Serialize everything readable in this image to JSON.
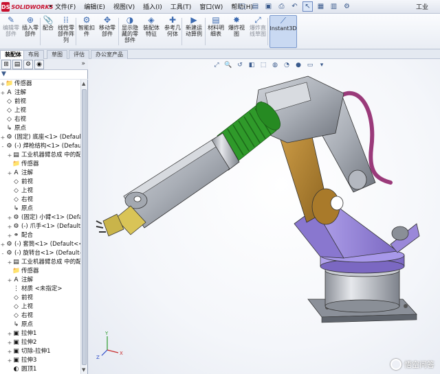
{
  "app": {
    "brand": "SOLIDWORKS",
    "logo_text": "DS",
    "title_partial": "工业"
  },
  "menu": {
    "items": [
      "文件(F)",
      "编辑(E)",
      "视图(V)",
      "插入(I)",
      "工具(T)",
      "窗口(W)",
      "帮助(H)"
    ]
  },
  "quick_access": [
    {
      "icon": "new-document-icon",
      "glyph": "□"
    },
    {
      "icon": "open-icon",
      "glyph": "▤"
    },
    {
      "icon": "save-icon",
      "glyph": "▣"
    },
    {
      "icon": "print-icon",
      "glyph": "⎙"
    },
    {
      "icon": "undo-icon",
      "glyph": "↶"
    },
    {
      "icon": "select-icon",
      "glyph": "↖",
      "selected": true
    },
    {
      "icon": "rebuild-icon",
      "glyph": "▦"
    },
    {
      "icon": "file-properties-icon",
      "glyph": "▥"
    },
    {
      "icon": "options-icon",
      "glyph": "⚙"
    }
  ],
  "commands": [
    {
      "label": "编辑零\n部件",
      "icon": "edit-component-icon",
      "glyph": "✎",
      "gray": true
    },
    {
      "label": "插入零\n部件",
      "icon": "insert-component-icon",
      "glyph": "⊕"
    },
    {
      "label": "配合",
      "icon": "mate-icon",
      "glyph": "📎"
    },
    {
      "label": "线性零\n部件阵\n列",
      "icon": "linear-pattern-icon",
      "glyph": "⁞⁞"
    },
    {
      "label": "智能扣\n件",
      "icon": "smart-fasteners-icon",
      "glyph": "⚙"
    },
    {
      "label": "移动零\n部件",
      "icon": "move-component-icon",
      "glyph": "✥"
    },
    {
      "label": "显示隐\n藏的零\n部件",
      "icon": "show-hidden-icon",
      "glyph": "◑"
    },
    {
      "label": "装配体\n特征",
      "icon": "assembly-features-icon",
      "glyph": "◈"
    },
    {
      "label": "参考几\n何体",
      "icon": "reference-geometry-icon",
      "glyph": "✚"
    },
    {
      "label": "新建运\n动算例",
      "icon": "new-motion-study-icon",
      "glyph": "▶"
    },
    {
      "label": "材料明\n细表",
      "icon": "bom-icon",
      "glyph": "▤"
    },
    {
      "label": "爆炸视\n图",
      "icon": "exploded-view-icon",
      "glyph": "✸"
    },
    {
      "label": "爆炸直\n线草图",
      "icon": "explode-line-sketch-icon",
      "glyph": "⤢",
      "gray": true
    },
    {
      "label": "Instant3D",
      "icon": "instant3d-icon",
      "glyph": "⟋",
      "active": true
    }
  ],
  "tabs": [
    "装配体",
    "布局",
    "草图",
    "评估",
    "办公室产品"
  ],
  "active_tab": 0,
  "feature_manager": {
    "tab_icons": [
      {
        "icon": "feature-tree-icon",
        "glyph": "⊞"
      },
      {
        "icon": "property-manager-icon",
        "glyph": "▤"
      },
      {
        "icon": "configuration-manager-icon",
        "glyph": "⚙"
      },
      {
        "icon": "display-manager-icon",
        "glyph": "◉"
      }
    ],
    "collapse_glyph": "»",
    "filter_glyph": "▼",
    "tree": [
      {
        "indent": 0,
        "exp": "+",
        "icon": "sensor-icon",
        "glyph": "📁",
        "text": "传感器"
      },
      {
        "indent": 0,
        "exp": "+",
        "icon": "annotation-icon",
        "glyph": "A",
        "text": "注解"
      },
      {
        "indent": 0,
        "exp": "",
        "icon": "plane-icon",
        "glyph": "◇",
        "text": "前视"
      },
      {
        "indent": 0,
        "exp": "",
        "icon": "plane-icon",
        "glyph": "◇",
        "text": "上视"
      },
      {
        "indent": 0,
        "exp": "",
        "icon": "plane-icon",
        "glyph": "◇",
        "text": "右视"
      },
      {
        "indent": 0,
        "exp": "",
        "icon": "origin-icon",
        "glyph": "↳",
        "text": "原点"
      },
      {
        "indent": 0,
        "exp": "+",
        "icon": "part-icon",
        "glyph": "⚙",
        "text": "(固定) 底座<1> (Default"
      },
      {
        "indent": 0,
        "exp": "-",
        "icon": "subassembly-icon",
        "glyph": "⚙",
        "text": "(-) 焊枪结构<1> (Defau"
      },
      {
        "indent": 1,
        "exp": "+",
        "icon": "history-icon",
        "glyph": "▤",
        "text": "工业机器臂总成 中的配"
      },
      {
        "indent": 1,
        "exp": "",
        "icon": "sensor-icon",
        "glyph": "📁",
        "text": "传感器"
      },
      {
        "indent": 1,
        "exp": "+",
        "icon": "annotation-icon",
        "glyph": "A",
        "text": "注解"
      },
      {
        "indent": 1,
        "exp": "",
        "icon": "plane-icon",
        "glyph": "◇",
        "text": "前视"
      },
      {
        "indent": 1,
        "exp": "",
        "icon": "plane-icon",
        "glyph": "◇",
        "text": "上视"
      },
      {
        "indent": 1,
        "exp": "",
        "icon": "plane-icon",
        "glyph": "◇",
        "text": "右视"
      },
      {
        "indent": 1,
        "exp": "",
        "icon": "origin-icon",
        "glyph": "↳",
        "text": "原点"
      },
      {
        "indent": 1,
        "exp": "+",
        "icon": "part-icon",
        "glyph": "⚙",
        "text": "(固定) 小臂<1> (Defa"
      },
      {
        "indent": 1,
        "exp": "+",
        "icon": "part-icon",
        "glyph": "⚙",
        "text": "(-) 爪手<1> (Default"
      },
      {
        "indent": 1,
        "exp": "+",
        "icon": "mates-icon",
        "glyph": "⚭",
        "text": "配合"
      },
      {
        "indent": 0,
        "exp": "+",
        "icon": "part-icon",
        "glyph": "⚙",
        "text": "(-) 套筒<1> (Default<<"
      },
      {
        "indent": 0,
        "exp": "-",
        "icon": "part-icon",
        "glyph": "⚙",
        "text": "(-) 旋转台<1> (Default-"
      },
      {
        "indent": 1,
        "exp": "+",
        "icon": "history-icon",
        "glyph": "▤",
        "text": "工业机器臂总成 中的配"
      },
      {
        "indent": 1,
        "exp": "",
        "icon": "sensor-icon",
        "glyph": "📁",
        "text": "传感器"
      },
      {
        "indent": 1,
        "exp": "+",
        "icon": "annotation-icon",
        "glyph": "A",
        "text": "注解"
      },
      {
        "indent": 1,
        "exp": "",
        "icon": "material-icon",
        "glyph": "⋮",
        "text": "材质 <未指定>"
      },
      {
        "indent": 1,
        "exp": "",
        "icon": "plane-icon",
        "glyph": "◇",
        "text": "前视"
      },
      {
        "indent": 1,
        "exp": "",
        "icon": "plane-icon",
        "glyph": "◇",
        "text": "上视"
      },
      {
        "indent": 1,
        "exp": "",
        "icon": "plane-icon",
        "glyph": "◇",
        "text": "右视"
      },
      {
        "indent": 1,
        "exp": "",
        "icon": "origin-icon",
        "glyph": "↳",
        "text": "原点"
      },
      {
        "indent": 1,
        "exp": "+",
        "icon": "extrude-icon",
        "glyph": "▣",
        "text": "拉伸1"
      },
      {
        "indent": 1,
        "exp": "+",
        "icon": "extrude-icon",
        "glyph": "▣",
        "text": "拉伸2"
      },
      {
        "indent": 1,
        "exp": "+",
        "icon": "cut-extrude-icon",
        "glyph": "▣",
        "text": "切除-拉伸1"
      },
      {
        "indent": 1,
        "exp": "+",
        "icon": "extrude-icon",
        "glyph": "▣",
        "text": "拉伸3"
      },
      {
        "indent": 1,
        "exp": "",
        "icon": "fillet-icon",
        "glyph": "◐",
        "text": "圆顶1"
      }
    ],
    "scroll_up": "▲",
    "scroll_down": "▼"
  },
  "viewport": {
    "hud": [
      {
        "icon": "zoom-fit-icon",
        "glyph": "⤢"
      },
      {
        "icon": "zoom-area-icon",
        "glyph": "🔍"
      },
      {
        "icon": "previous-view-icon",
        "glyph": "↺"
      },
      {
        "icon": "section-view-icon",
        "glyph": "◧"
      },
      {
        "icon": "view-orientation-icon",
        "glyph": "⬚"
      },
      {
        "icon": "display-style-icon",
        "glyph": "◍"
      },
      {
        "icon": "hide-show-icon",
        "glyph": "◔"
      },
      {
        "icon": "appearance-icon",
        "glyph": "●"
      },
      {
        "icon": "scene-icon",
        "glyph": "▭"
      },
      {
        "icon": "view-settings-icon",
        "glyph": "▾"
      }
    ],
    "triad": {
      "x": "X",
      "y": "Y",
      "z": "Z"
    },
    "watermark": "悟空问答",
    "colors": {
      "gray_metal": "#a9aeb6",
      "spring_green": "#2f9a2a",
      "link_brown": "#b7862e",
      "base_purple": "#9a88d9",
      "cable_magenta": "#9a3a7a",
      "gripper_yellow": "#d9c457"
    }
  }
}
